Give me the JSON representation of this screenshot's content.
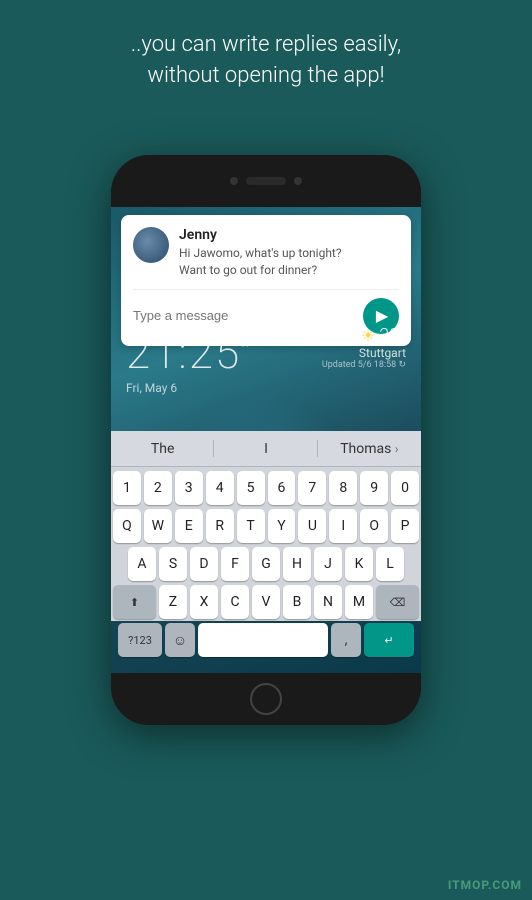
{
  "top_text": {
    "line1": "..you can write replies easily,",
    "line2": "without opening the app!"
  },
  "notification": {
    "contact_name": "Jenny",
    "message_line1": "Hi Jawomo, what's up tonight?",
    "message_line2": "Want to go out for dinner?",
    "reply_placeholder": "Type a message"
  },
  "lock_screen": {
    "time": "21:25",
    "time_symbol": "*",
    "date": "Fri, May 6",
    "weather": {
      "temp": "22°",
      "city": "Stuttgart",
      "updated": "Updated 5/6 18:58 ↻"
    }
  },
  "keyboard": {
    "suggestions": [
      "The",
      "I",
      "Thomas"
    ],
    "rows": {
      "numbers": [
        "1",
        "2",
        "3",
        "4",
        "5",
        "6",
        "7",
        "8",
        "9",
        "0"
      ],
      "row1": [
        "Q",
        "W",
        "E",
        "R",
        "T",
        "Y",
        "U",
        "I",
        "O",
        "P"
      ],
      "row2": [
        "A",
        "S",
        "D",
        "F",
        "G",
        "H",
        "J",
        "K",
        "L"
      ],
      "row3": [
        "Z",
        "X",
        "C",
        "V",
        "B",
        "N",
        "M"
      ]
    }
  },
  "watermark": "ITMOP.COM"
}
